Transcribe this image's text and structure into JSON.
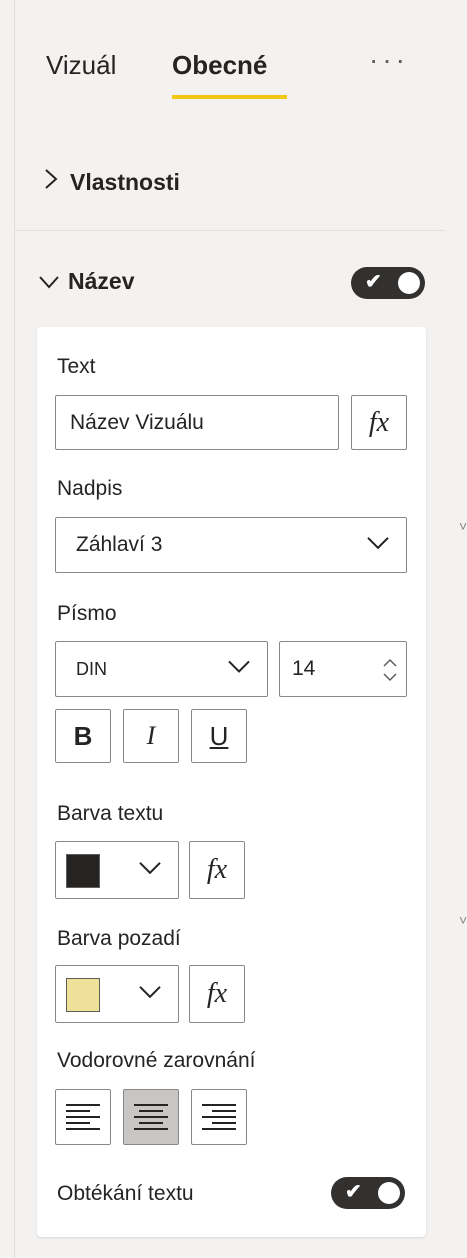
{
  "tabs": {
    "visual": "Vizuál",
    "general": "Obecné",
    "more": "···"
  },
  "sections": {
    "properties": "Vlastnosti",
    "title": "Název",
    "title_toggle": "on"
  },
  "fields": {
    "text_label": "Text",
    "text_value": "Název Vizuálu",
    "heading_label": "Nadpis",
    "heading_value": "Záhlaví 3",
    "font_label": "Písmo",
    "font_family": "DIN",
    "font_size": "14",
    "bold": "B",
    "italic": "I",
    "underline": "U",
    "text_color_label": "Barva textu",
    "text_color": "#252423",
    "background_color_label": "Barva pozadí",
    "background_color": "#f0e19a",
    "alignment_label": "Vodorovné zarovnání",
    "alignment_selected": "center",
    "wrap_label": "Obtékání textu",
    "wrap_toggle": "on",
    "fx": "fx"
  },
  "colors": {
    "accent": "#f2c811",
    "toggle_bg": "#323130",
    "selected_bg": "#c8c6c4"
  }
}
